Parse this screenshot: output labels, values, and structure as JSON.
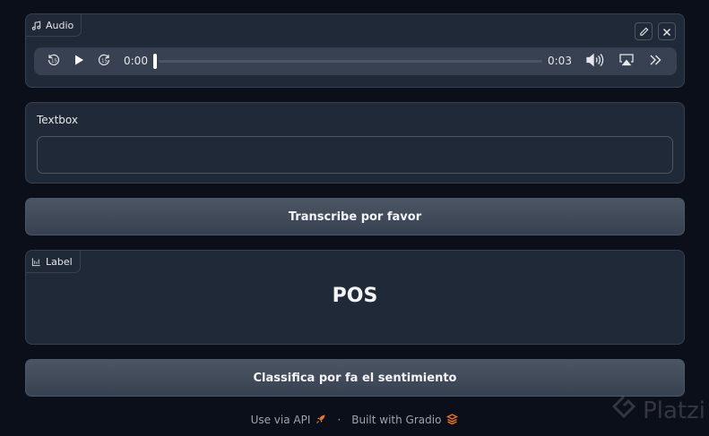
{
  "audio": {
    "tag_label": "Audio",
    "tag_icon": "music-note-icon",
    "current_time": "0:00",
    "duration": "0:03",
    "progress": 0.0
  },
  "textbox": {
    "label": "Textbox",
    "value": "",
    "placeholder": ""
  },
  "transcribe_button": {
    "label": "Transcribe por favor"
  },
  "label_output": {
    "tag_label": "Label",
    "tag_icon": "bar-chart-icon",
    "value": "POS"
  },
  "classify_button": {
    "label": "Classifica por fa el sentimiento"
  },
  "footer": {
    "api_link": "Use via API",
    "separator": "·",
    "built_with": "Built with Gradio"
  },
  "watermark": {
    "text": "Platzi"
  },
  "colors": {
    "background": "#0b0f19",
    "block": "#1f2937",
    "border": "#374151",
    "accent": "#f97316"
  }
}
